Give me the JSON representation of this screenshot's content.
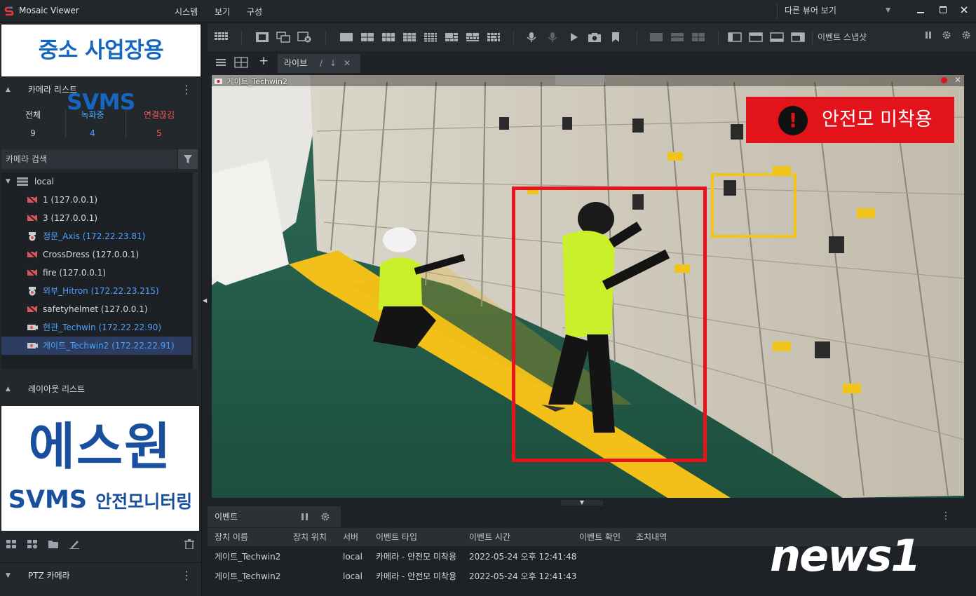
{
  "app": {
    "title": "Mosaic Viewer",
    "menu": [
      "시스템",
      "보기",
      "구성"
    ],
    "other_view": "다른 뷰어 보기"
  },
  "colors": {
    "recording": "#4aa3ff",
    "disconnected": "#ff5a5a",
    "alert": "#e2131b",
    "detect_box": "#e8141c",
    "selected_row": "#2c3d61"
  },
  "left": {
    "banner_top": "중소 사업장용 SVMS",
    "camera_list": {
      "title": "카메라 리스트",
      "stats": [
        {
          "label": "전체",
          "value": "9",
          "color": "#cfd3d8"
        },
        {
          "label": "녹화중",
          "value": "4",
          "color": "#4aa3ff"
        },
        {
          "label": "연결끊김",
          "value": "5",
          "color": "#ff5a5a"
        }
      ],
      "search_label": "카메라 검색",
      "root": "local",
      "items": [
        {
          "name": "1 (127.0.0.1)",
          "icon": "camera-disconnected-icon",
          "color": "#d8dbde"
        },
        {
          "name": "3 (127.0.0.1)",
          "icon": "camera-disconnected-icon",
          "color": "#d8dbde"
        },
        {
          "name": "정문_Axis (172.22.23.81)",
          "icon": "dome-camera-icon",
          "color": "#4aa3ff"
        },
        {
          "name": "CrossDress (127.0.0.1)",
          "icon": "camera-disconnected-icon",
          "color": "#d8dbde"
        },
        {
          "name": "fire (127.0.0.1)",
          "icon": "camera-disconnected-icon",
          "color": "#d8dbde"
        },
        {
          "name": "외부_Hitron (172.22.23.215)",
          "icon": "dome-camera-icon",
          "color": "#4aa3ff"
        },
        {
          "name": "safetyhelmet (127.0.0.1)",
          "icon": "camera-disconnected-icon",
          "color": "#d8dbde"
        },
        {
          "name": "현관_Techwin (172.22.22.90)",
          "icon": "camera-icon",
          "color": "#4aa3ff"
        },
        {
          "name": "게이트_Techwin2 (172.22.22.91)",
          "icon": "camera-icon",
          "color": "#4aa3ff",
          "selected": true
        }
      ]
    },
    "layout_list": {
      "title": "레이아웃 리스트"
    },
    "banner_bottom": {
      "line1": "에스원",
      "line2a": "SVMS",
      "line2b": "안전모니터링"
    },
    "ptz": {
      "title": "PTZ 카메라"
    }
  },
  "main": {
    "snapshot_label": "이벤트 스냅샷",
    "tab": {
      "label": "라이브"
    },
    "video": {
      "camera_label": "게이트_Techwin2",
      "alert_text": "안전모 미착용",
      "alert_mark": "!"
    }
  },
  "events": {
    "tab_label": "이벤트",
    "columns": [
      "장치 이름",
      "장치 위치",
      "서버",
      "이벤트 타입",
      "이벤트 시간",
      "이벤트 확인",
      "조치내역"
    ],
    "rows": [
      {
        "device": "게이트_Techwin2",
        "location": "",
        "server": "local",
        "type": "카메라 - 안전모 미착용",
        "time": "2022-05-24 오후 12:41:48",
        "checked": "",
        "action": ""
      },
      {
        "device": "게이트_Techwin2",
        "location": "",
        "server": "local",
        "type": "카메라 - 안전모 미착용",
        "time": "2022-05-24 오후 12:41:43",
        "checked": "",
        "action": ""
      }
    ]
  },
  "watermark": {
    "text": "news1"
  }
}
